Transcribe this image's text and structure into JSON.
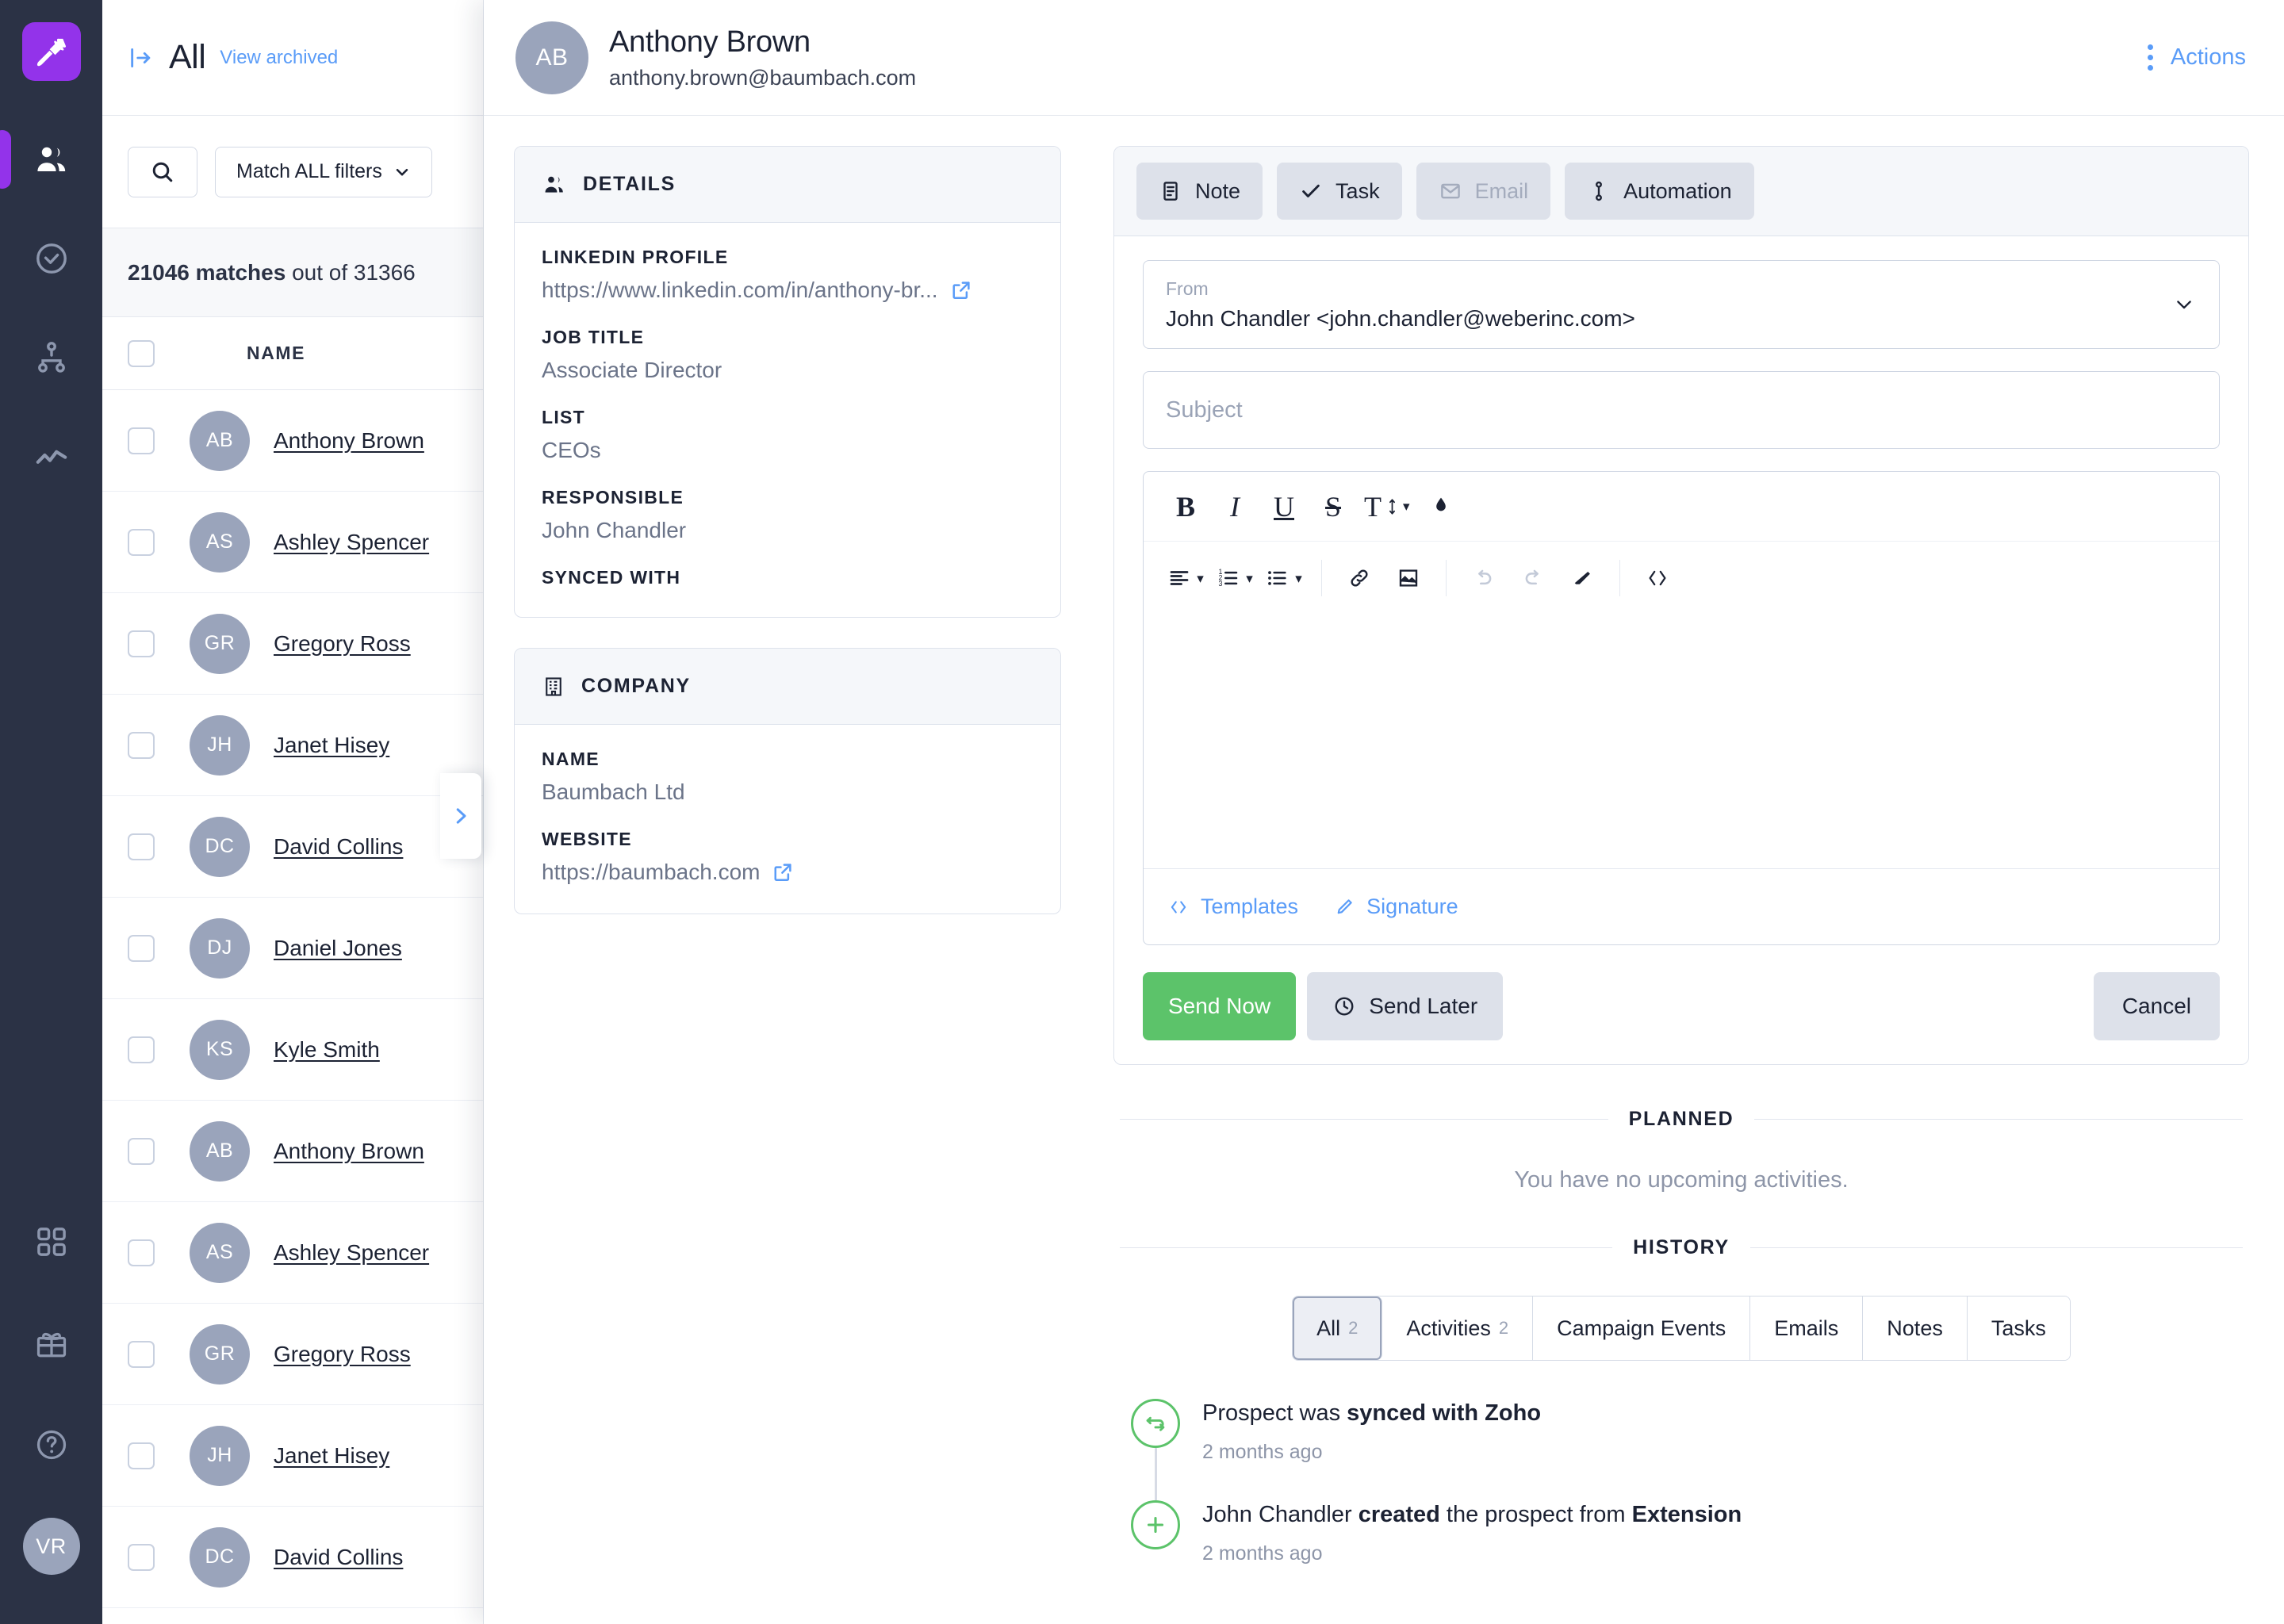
{
  "rail": {
    "logo_icon": "carrot-logo-icon",
    "items": [
      {
        "icon": "people-icon",
        "name": "prospects",
        "active": true
      },
      {
        "icon": "check-circle-icon",
        "name": "tasks",
        "active": false
      },
      {
        "icon": "sitemap-icon",
        "name": "campaigns",
        "active": false
      },
      {
        "icon": "analytics-icon",
        "name": "analytics",
        "active": false
      }
    ],
    "bottom_items": [
      {
        "icon": "grid-apps-icon",
        "name": "apps"
      },
      {
        "icon": "gift-icon",
        "name": "rewards"
      },
      {
        "icon": "help-circle-icon",
        "name": "help"
      }
    ],
    "user_initials": "VR"
  },
  "list": {
    "title": "All",
    "view_archived_label": "View archived",
    "collapse_icon": "collapse-panel-icon",
    "search_icon": "search-icon",
    "match_filter_label": "Match ALL filters",
    "matches_count": "21046",
    "matches_word": "matches",
    "out_of_text": "out of 31366",
    "column_name": "NAME",
    "rows": [
      {
        "initials": "AB",
        "name": "Anthony Brown"
      },
      {
        "initials": "AS",
        "name": "Ashley Spencer"
      },
      {
        "initials": "GR",
        "name": "Gregory Ross"
      },
      {
        "initials": "JH",
        "name": "Janet Hisey"
      },
      {
        "initials": "DC",
        "name": "David Collins"
      },
      {
        "initials": "DJ",
        "name": "Daniel Jones"
      },
      {
        "initials": "KS",
        "name": "Kyle Smith"
      },
      {
        "initials": "AB",
        "name": "Anthony Brown"
      },
      {
        "initials": "AS",
        "name": "Ashley Spencer"
      },
      {
        "initials": "GR",
        "name": "Gregory Ross"
      },
      {
        "initials": "JH",
        "name": "Janet Hisey"
      },
      {
        "initials": "DC",
        "name": "David Collins"
      }
    ]
  },
  "header": {
    "initials": "AB",
    "name": "Anthony Brown",
    "email": "anthony.brown@baumbach.com",
    "actions_label": "Actions",
    "kebab_icon": "kebab-menu-icon"
  },
  "details_card": {
    "icon": "people-icon",
    "title": "DETAILS",
    "fields": [
      {
        "label": "LINKEDIN PROFILE",
        "value": "https://www.linkedin.com/in/anthony-br...",
        "link": true
      },
      {
        "label": "JOB TITLE",
        "value": "Associate Director",
        "link": false
      },
      {
        "label": "LIST",
        "value": "CEOs",
        "link": false
      },
      {
        "label": "RESPONSIBLE",
        "value": "John Chandler",
        "link": false
      },
      {
        "label": "SYNCED WITH",
        "value": "",
        "link": false
      }
    ]
  },
  "company_card": {
    "icon": "building-icon",
    "title": "COMPANY",
    "fields": [
      {
        "label": "NAME",
        "value": "Baumbach Ltd",
        "link": false
      },
      {
        "label": "WEBSITE",
        "value": "https://baumbach.com",
        "link": true
      }
    ]
  },
  "composer": {
    "tabs": [
      {
        "label": "Note",
        "icon": "note-icon",
        "disabled": false
      },
      {
        "label": "Task",
        "icon": "check-icon",
        "disabled": false
      },
      {
        "label": "Email",
        "icon": "envelope-icon",
        "disabled": true
      },
      {
        "label": "Automation",
        "icon": "automation-icon",
        "disabled": false
      }
    ],
    "from_label": "From",
    "from_value": "John Chandler <john.chandler@weberinc.com>",
    "from_caret_icon": "chevron-down-icon",
    "subject_placeholder": "Subject",
    "toolbar_row1": [
      {
        "icon": "bold-icon",
        "glyph": "B",
        "bold": true
      },
      {
        "icon": "italic-icon",
        "glyph": "I",
        "italic": true
      },
      {
        "icon": "underline-icon",
        "glyph": "U",
        "underline": true
      },
      {
        "icon": "strikethrough-icon",
        "glyph": "S",
        "strike": true
      },
      {
        "icon": "font-size-icon",
        "glyph": "T",
        "caret": true
      },
      {
        "icon": "text-color-icon",
        "glyph": "",
        "caret": false
      }
    ],
    "toolbar_row2": [
      {
        "icon": "align-left-icon",
        "caret": true
      },
      {
        "icon": "ordered-list-icon",
        "caret": true
      },
      {
        "icon": "bullet-list-icon",
        "caret": true
      },
      {
        "icon": "link-icon",
        "caret": false
      },
      {
        "icon": "image-icon",
        "caret": false
      },
      {
        "icon": "undo-icon",
        "caret": false,
        "disabled": true
      },
      {
        "icon": "redo-icon",
        "caret": false,
        "disabled": true
      },
      {
        "icon": "clear-format-icon",
        "caret": false
      },
      {
        "icon": "code-icon",
        "caret": false
      }
    ],
    "templates_label": "Templates",
    "templates_icon": "code-icon",
    "signature_label": "Signature",
    "signature_icon": "pen-icon",
    "send_now_label": "Send Now",
    "send_later_label": "Send Later",
    "send_later_icon": "clock-icon",
    "cancel_label": "Cancel",
    "send_now_color": "#5cc36a"
  },
  "planned": {
    "section_label": "PLANNED",
    "empty_text": "You have no upcoming activities."
  },
  "history": {
    "section_label": "HISTORY",
    "tabs": [
      {
        "label": "All",
        "count": "2",
        "selected": true
      },
      {
        "label": "Activities",
        "count": "2",
        "selected": false
      },
      {
        "label": "Campaign Events",
        "count": "",
        "selected": false
      },
      {
        "label": "Emails",
        "count": "",
        "selected": false
      },
      {
        "label": "Notes",
        "count": "",
        "selected": false
      },
      {
        "label": "Tasks",
        "count": "",
        "selected": false
      }
    ],
    "events": [
      {
        "icon": "sync-icon",
        "prefix": "Prospect was ",
        "strong": "synced with Zoho",
        "suffix": "",
        "strong2": "",
        "time": "2 months ago"
      },
      {
        "icon": "plus-icon",
        "prefix": "John Chandler ",
        "strong": "created",
        "suffix": " the prospect from ",
        "strong2": "Extension",
        "time": "2 months ago"
      }
    ]
  },
  "peek": {
    "icon": "chevron-right-icon"
  }
}
